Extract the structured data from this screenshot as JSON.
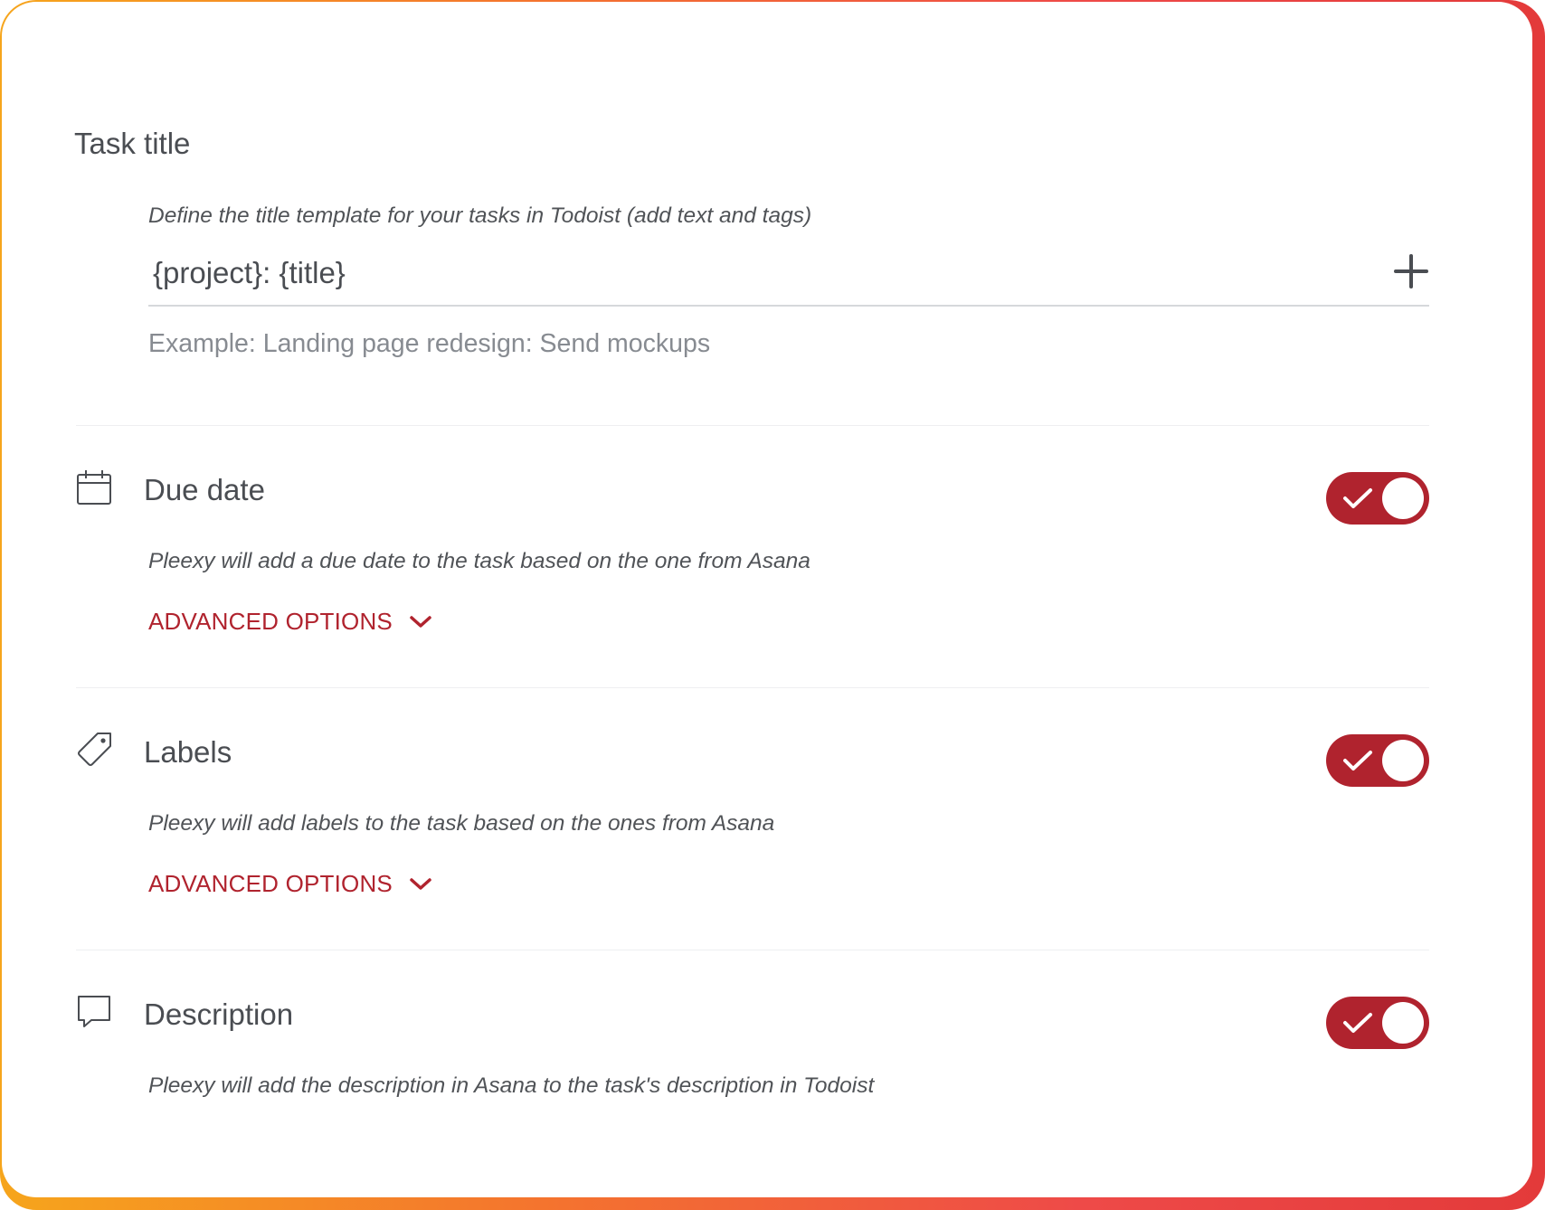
{
  "task_title": {
    "heading": "Task title",
    "description": "Define the title template for your tasks in Todoist (add text and tags)",
    "template_value": "{project}: {title}",
    "example": "Example: Landing page redesign: Send mockups"
  },
  "due_date": {
    "icon": "calendar-icon",
    "heading": "Due date",
    "description": "Pleexy will add a due date to the task based on the one from Asana",
    "advanced_label": "ADVANCED OPTIONS",
    "enabled": true
  },
  "labels": {
    "icon": "tag-icon",
    "heading": "Labels",
    "description": "Pleexy will add labels to the task based on the ones from Asana",
    "advanced_label": "ADVANCED OPTIONS",
    "enabled": true
  },
  "description_section": {
    "icon": "speech-bubble-icon",
    "heading": "Description",
    "description": "Pleexy will add the description in Asana to the task's description in Todoist",
    "enabled": true
  },
  "colors": {
    "accent": "#b0232e",
    "text": "#4a4d52",
    "muted": "#878b91"
  }
}
